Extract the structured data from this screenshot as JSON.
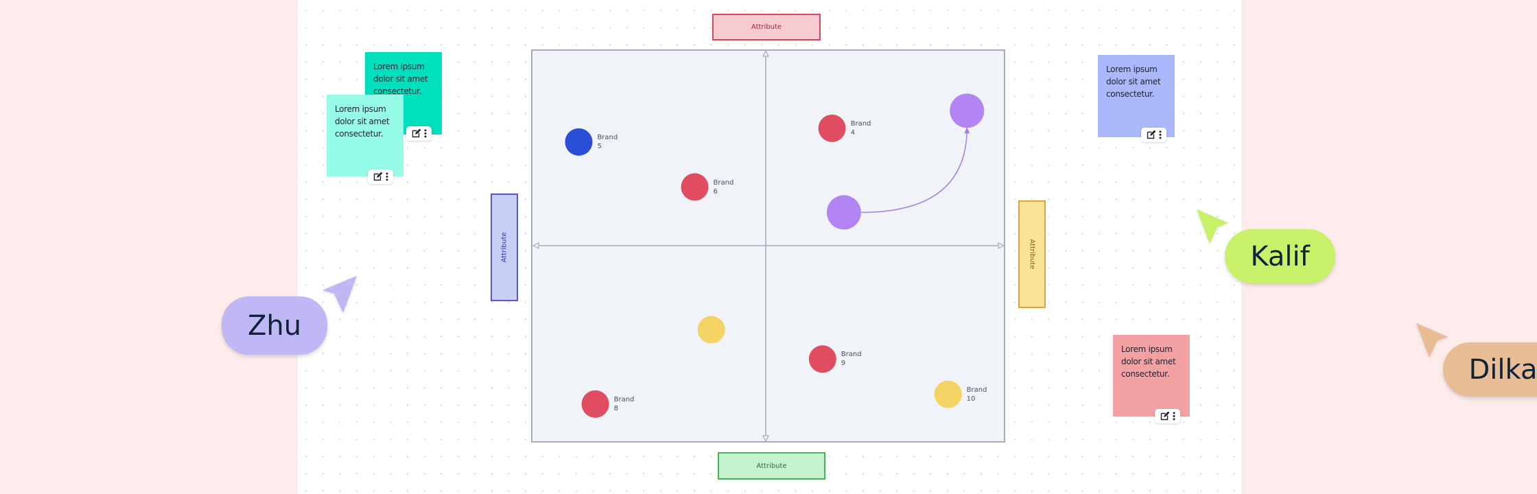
{
  "board": {
    "background_color": "#fdeceb",
    "canvas_color": "#ffffff"
  },
  "sticky_notes": [
    {
      "id": "dark-teal",
      "text": "Lorem ipsum dolor sit amet consectetur.",
      "color": "#00e0bf"
    },
    {
      "id": "light-teal",
      "text": "Lorem ipsum dolor sit amet consectetur.",
      "color": "#96fbe6"
    },
    {
      "id": "periwinkle",
      "text": "Lorem ipsum dolor sit amet consectetur.",
      "color": "#abb8fb"
    },
    {
      "id": "salmon",
      "text": "Lorem ipsum dolor sit amet consectetur.",
      "color": "#f4a1a4"
    }
  ],
  "sticky_toolbar": {
    "edit_icon": "edit-icon",
    "more_icon": "more-vertical-icon"
  },
  "attributes": {
    "top": "Attribute",
    "bottom": "Attribute",
    "left": "Attribute",
    "right": "Attribute"
  },
  "chart_data": {
    "type": "scatter",
    "title": "",
    "xlabel": "Attribute",
    "ylabel": "Attribute",
    "xlim": [
      -1,
      1
    ],
    "ylim": [
      -1,
      1
    ],
    "grid": false,
    "quadrant_axes": true,
    "points": [
      {
        "label": "Brand 5",
        "line1": "Brand",
        "line2": "5",
        "x": -0.79,
        "y": 0.53,
        "color": "#2a4fd6",
        "size": "small"
      },
      {
        "label": "Brand 6",
        "line1": "Brand",
        "line2": "6",
        "x": -0.3,
        "y": 0.3,
        "color": "#e04c62",
        "size": "small"
      },
      {
        "label": "Brand 4",
        "line1": "Brand",
        "line2": "4",
        "x": 0.28,
        "y": 0.6,
        "color": "#e04c62",
        "size": "small"
      },
      {
        "label": "",
        "line1": "",
        "line2": "",
        "x": 0.85,
        "y": 0.69,
        "color": "#b384f4",
        "size": "large"
      },
      {
        "label": "",
        "line1": "",
        "line2": "",
        "x": 0.33,
        "y": 0.17,
        "color": "#b384f4",
        "size": "large"
      },
      {
        "label": "",
        "line1": "",
        "line2": "",
        "x": -0.23,
        "y": -0.43,
        "color": "#f5d264",
        "size": "small"
      },
      {
        "label": "Brand 9",
        "line1": "Brand",
        "line2": "9",
        "x": 0.24,
        "y": -0.58,
        "color": "#e04c62",
        "size": "small"
      },
      {
        "label": "Brand 10",
        "line1": "Brand",
        "line2": "10",
        "x": 0.77,
        "y": -0.76,
        "color": "#f5d264",
        "size": "small"
      },
      {
        "label": "Brand 8",
        "line1": "Brand",
        "line2": "8",
        "x": -0.72,
        "y": -0.81,
        "color": "#e04c62",
        "size": "small"
      }
    ],
    "connectors": [
      {
        "from": 4,
        "to": 3,
        "color": "#a57de8",
        "style": "curved-arrow"
      }
    ]
  },
  "collaborators": [
    {
      "name": "Zhu",
      "color": "#bfb7f6",
      "cursor_color": "#bfb7f6"
    },
    {
      "name": "Kalif",
      "color": "#c8f169",
      "cursor_color": "#c8f169"
    },
    {
      "name": "Dilka",
      "color": "#e8bc95",
      "cursor_color": "#e8bc95"
    }
  ]
}
